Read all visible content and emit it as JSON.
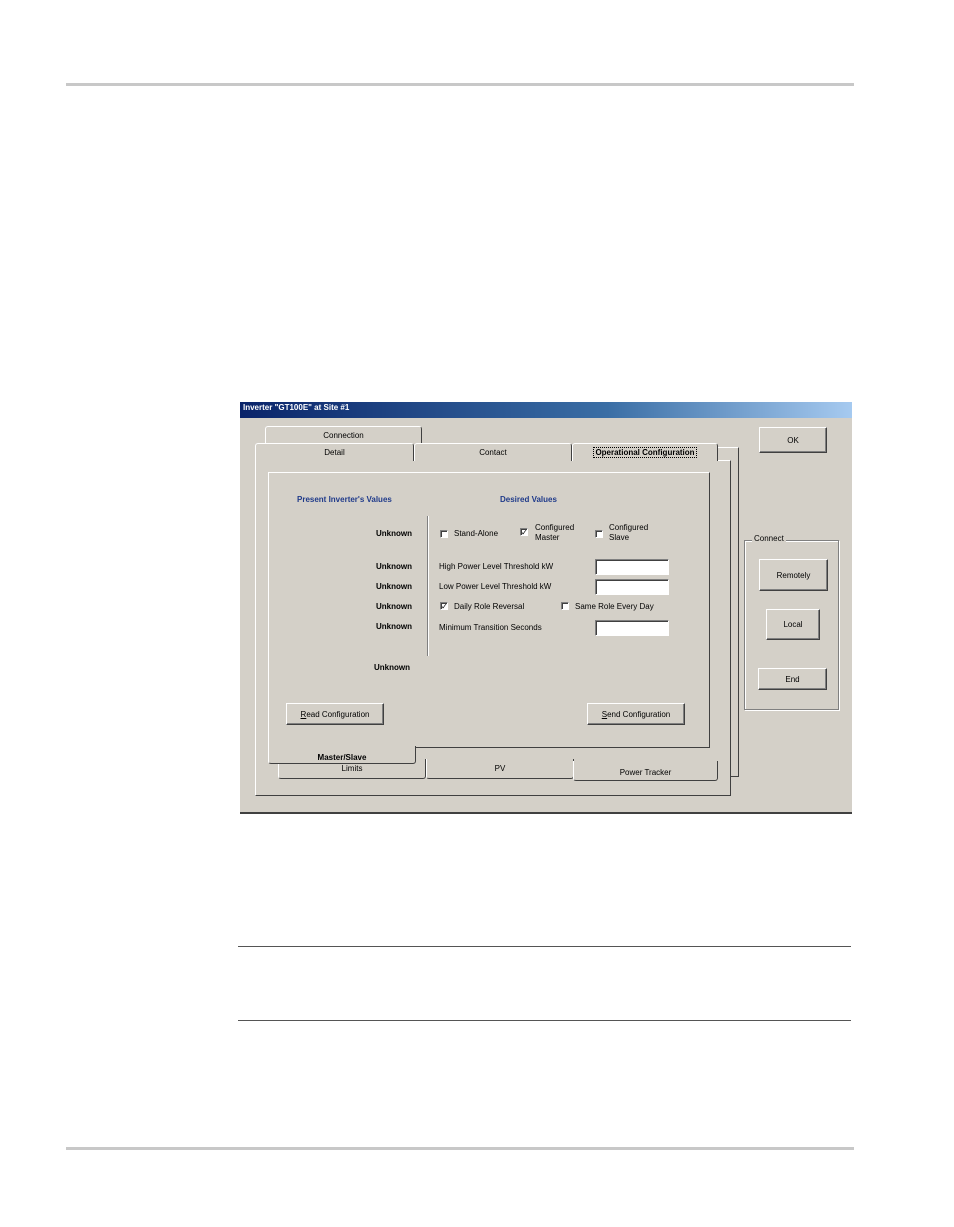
{
  "window": {
    "title": "Inverter \"GT100E\" at Site #1"
  },
  "tabs": {
    "row_top": [
      "Connection"
    ],
    "row_second": [
      "Detail",
      "Contact",
      "Operational Configuration"
    ],
    "active": "Master/Slave",
    "row_bottom": [
      "Limits",
      "PV",
      "Power Tracker"
    ]
  },
  "content": {
    "present_header": "Present Inverter's Values",
    "desired_header": "Desired Values",
    "present_values": [
      "Unknown",
      "Unknown",
      "Unknown",
      "Unknown",
      "Unknown",
      "Unknown"
    ],
    "role_options": [
      {
        "label": "Stand-Alone",
        "checked": false
      },
      {
        "label_line1": "Configured",
        "label_line2": "Master",
        "checked": true
      },
      {
        "label_line1": "Configured",
        "label_line2": "Slave",
        "checked": false
      }
    ],
    "high_power_label": "High Power Level Threshold kW",
    "high_power_value": "",
    "low_power_label": "Low Power Level Threshold kW",
    "low_power_value": "",
    "daily_reversal_label": "Daily Role Reversal",
    "daily_reversal_checked": true,
    "same_role_label": "Same Role Every Day",
    "same_role_checked": false,
    "min_transition_label": "Minimum Transition Seconds",
    "min_transition_value": "",
    "read_button": {
      "mnemonic": "R",
      "rest": "ead Configuration"
    },
    "send_button": {
      "mnemonic": "S",
      "rest": "end Configuration"
    }
  },
  "side": {
    "ok_label": "OK",
    "connect_group_label": "Connect",
    "remotely_label": "Remotely",
    "local_label": "Local",
    "end_label": "End"
  }
}
